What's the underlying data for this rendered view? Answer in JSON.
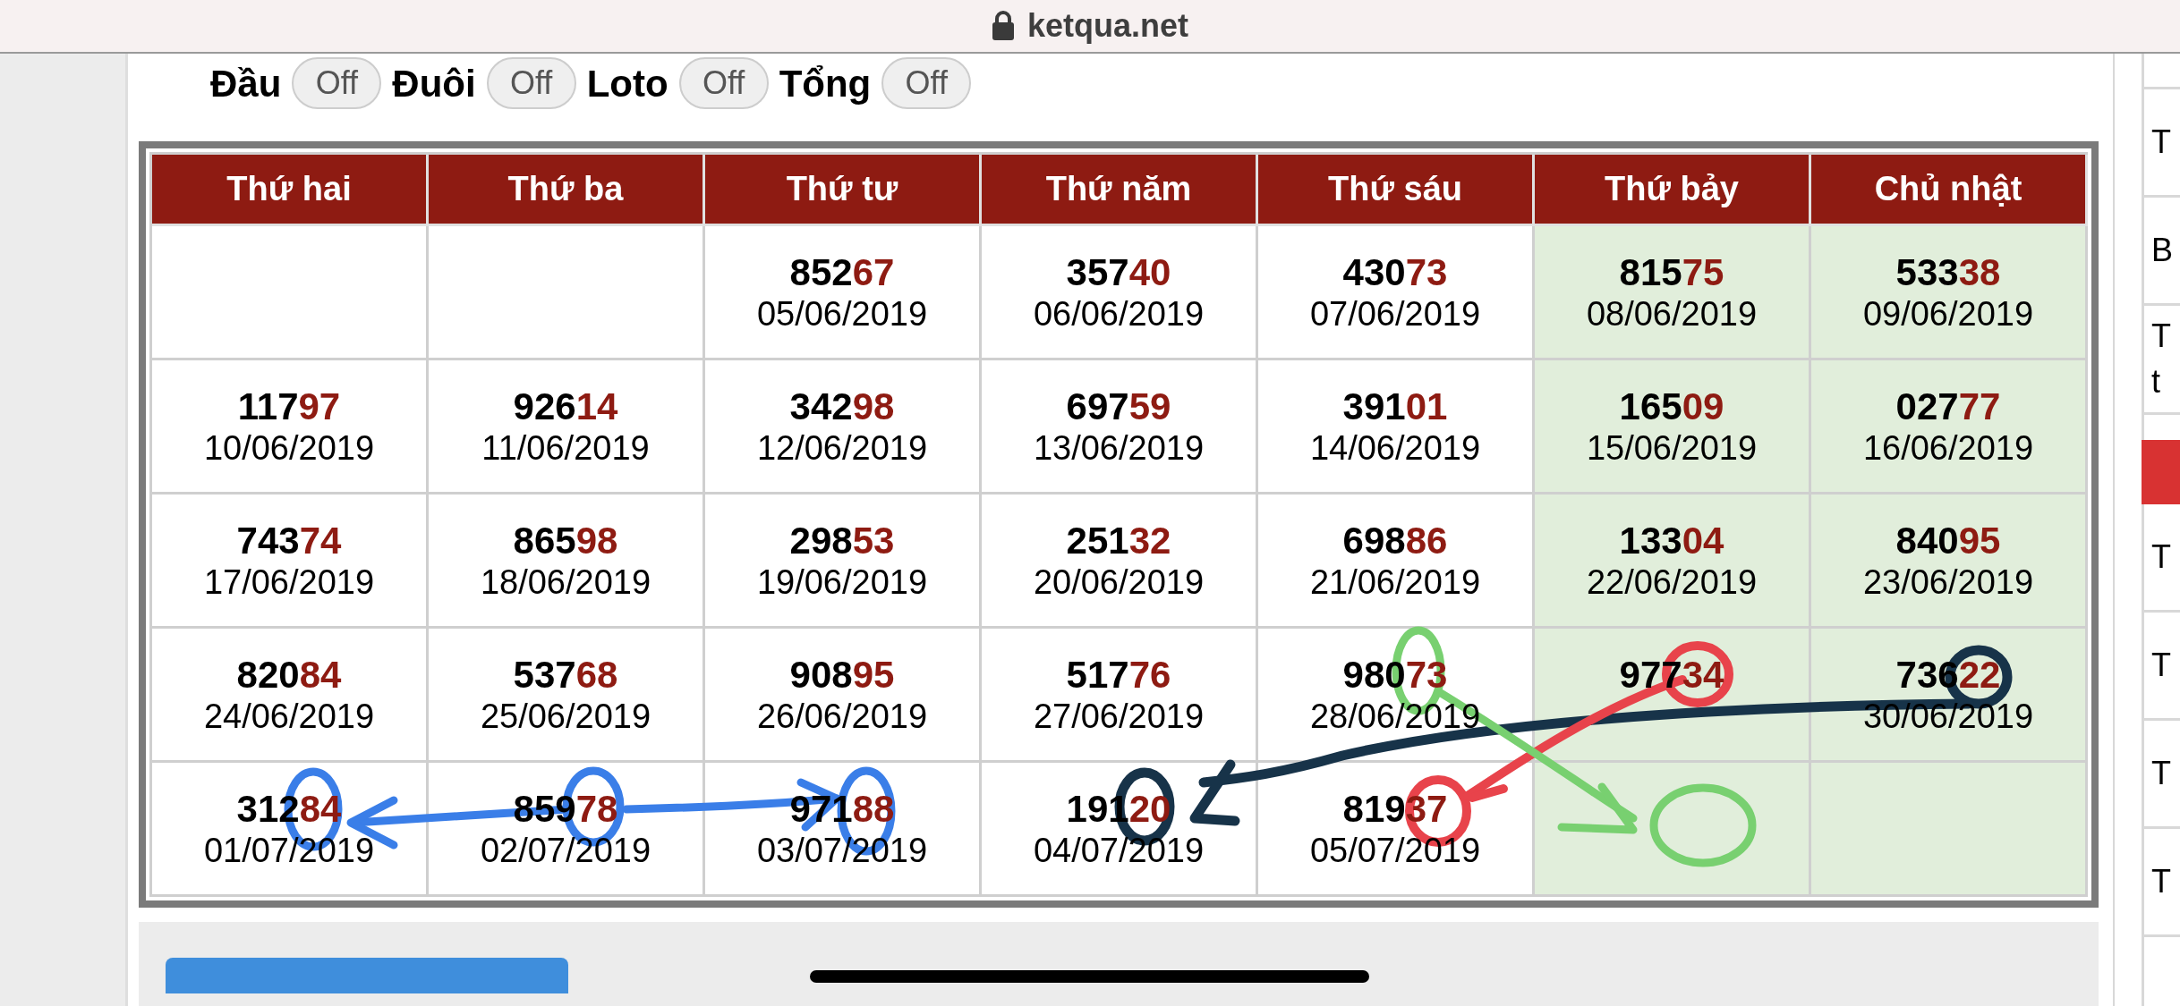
{
  "address_bar": {
    "url": "ketqua.net"
  },
  "toggles": [
    {
      "label": "Đầu",
      "state": "Off",
      "on": false
    },
    {
      "label": "Đuôi",
      "state": "Off",
      "on": false
    },
    {
      "label": "Loto",
      "state": "Off",
      "on": false
    },
    {
      "label": "Tổng",
      "state": "Off",
      "on": false
    }
  ],
  "calendar": {
    "columns": [
      {
        "label": "Thứ hai",
        "weekend": false
      },
      {
        "label": "Thứ ba",
        "weekend": false
      },
      {
        "label": "Thứ tư",
        "weekend": false
      },
      {
        "label": "Thứ năm",
        "weekend": false
      },
      {
        "label": "Thứ sáu",
        "weekend": false
      },
      {
        "label": "Thứ bảy",
        "weekend": true
      },
      {
        "label": "Chủ nhật",
        "weekend": true
      }
    ],
    "rows": [
      [
        null,
        null,
        {
          "head": "852",
          "tail": "67",
          "date": "05/06/2019"
        },
        {
          "head": "357",
          "tail": "40",
          "date": "06/06/2019"
        },
        {
          "head": "430",
          "tail": "73",
          "date": "07/06/2019"
        },
        {
          "head": "815",
          "tail": "75",
          "date": "08/06/2019"
        },
        {
          "head": "533",
          "tail": "38",
          "date": "09/06/2019"
        }
      ],
      [
        {
          "head": "117",
          "tail": "97",
          "date": "10/06/2019"
        },
        {
          "head": "926",
          "tail": "14",
          "date": "11/06/2019"
        },
        {
          "head": "342",
          "tail": "98",
          "date": "12/06/2019"
        },
        {
          "head": "697",
          "tail": "59",
          "date": "13/06/2019"
        },
        {
          "head": "391",
          "tail": "01",
          "date": "14/06/2019"
        },
        {
          "head": "165",
          "tail": "09",
          "date": "15/06/2019"
        },
        {
          "head": "027",
          "tail": "77",
          "date": "16/06/2019"
        }
      ],
      [
        {
          "head": "743",
          "tail": "74",
          "date": "17/06/2019"
        },
        {
          "head": "865",
          "tail": "98",
          "date": "18/06/2019"
        },
        {
          "head": "298",
          "tail": "53",
          "date": "19/06/2019"
        },
        {
          "head": "251",
          "tail": "32",
          "date": "20/06/2019"
        },
        {
          "head": "698",
          "tail": "86",
          "date": "21/06/2019"
        },
        {
          "head": "133",
          "tail": "04",
          "date": "22/06/2019"
        },
        {
          "head": "840",
          "tail": "95",
          "date": "23/06/2019"
        }
      ],
      [
        {
          "head": "820",
          "tail": "84",
          "date": "24/06/2019"
        },
        {
          "head": "537",
          "tail": "68",
          "date": "25/06/2019"
        },
        {
          "head": "908",
          "tail": "95",
          "date": "26/06/2019"
        },
        {
          "head": "517",
          "tail": "76",
          "date": "27/06/2019"
        },
        {
          "head": "980",
          "tail": "73",
          "date": "28/06/2019"
        },
        {
          "head": "977",
          "tail": "34"
        },
        {
          "head": "736",
          "tail": "22",
          "date": "30/06/2019"
        }
      ],
      [
        {
          "head": "312",
          "tail": "84",
          "date": "01/07/2019"
        },
        {
          "head": "859",
          "tail": "78",
          "date": "02/07/2019"
        },
        {
          "head": "971",
          "tail": "88",
          "date": "03/07/2019"
        },
        {
          "head": "191",
          "tail": "20",
          "date": "04/07/2019"
        },
        {
          "head": "819",
          "tail": "37",
          "date": "05/07/2019"
        },
        null,
        null
      ]
    ]
  },
  "sidebar": {
    "items": [
      {
        "kind": "row",
        "lines": [
          "T"
        ]
      },
      {
        "kind": "row",
        "lines": [
          "B"
        ]
      },
      {
        "kind": "row",
        "lines": [
          "T",
          "t"
        ]
      },
      {
        "kind": "header"
      },
      {
        "kind": "row",
        "lines": [
          "T"
        ]
      },
      {
        "kind": "row",
        "lines": [
          "T"
        ]
      },
      {
        "kind": "row",
        "lines": [
          "T"
        ]
      },
      {
        "kind": "row",
        "lines": [
          "T"
        ]
      }
    ]
  }
}
